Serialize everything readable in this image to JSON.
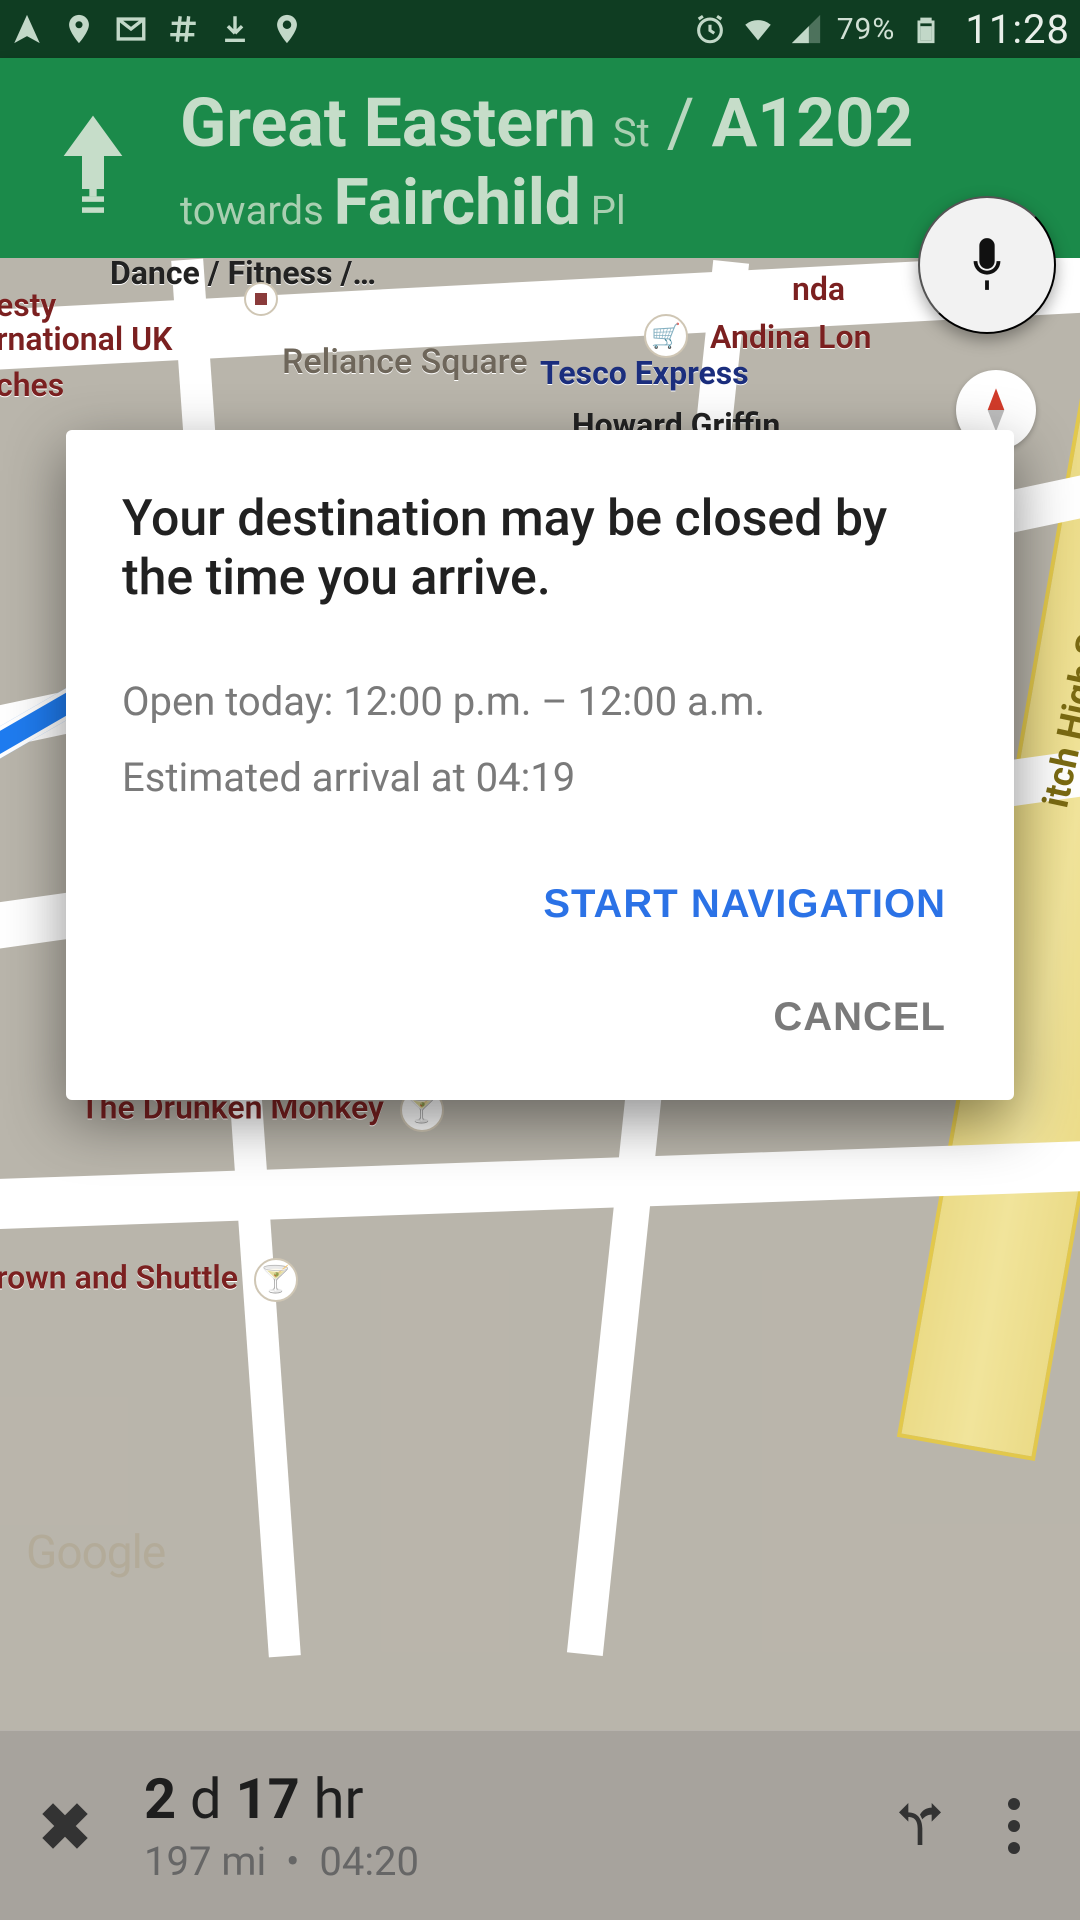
{
  "status_bar": {
    "battery_pct": "79%",
    "time": "11:28"
  },
  "nav_header": {
    "road_main": "Great Eastern",
    "road_suffix": "St",
    "slash": "/",
    "road_alt": "A1202",
    "towards_word": "towards",
    "towards_main": "Fairchild",
    "towards_suffix": "Pl"
  },
  "map": {
    "pois": {
      "dance": "Dance / Fitness /…",
      "nesty": "esty",
      "intl_uk": "rnational UK",
      "ches": "ches",
      "reliance": "Reliance Square",
      "tesco": "Tesco Express",
      "andina": "Andina Lon",
      "nda": "nda",
      "howard": "Howard Griffin",
      "shoreditch": "itch High St",
      "drunken": "The Drunken Monkey",
      "crown": "rown and Shuttle",
      "google": "Google"
    }
  },
  "dialog": {
    "title": "Your destination may be closed by the time you arrive.",
    "open_today": "Open today: 12:00 p.m. – 12:00 a.m.",
    "eta": "Estimated arrival at 04:19",
    "start": "START NAVIGATION",
    "cancel": "CANCEL"
  },
  "bottom_bar": {
    "dur_n1": "2",
    "dur_u1": "d",
    "dur_n2": "17",
    "dur_u2": "hr",
    "distance": "197 mi",
    "dot": "•",
    "arrive": "04:20"
  }
}
